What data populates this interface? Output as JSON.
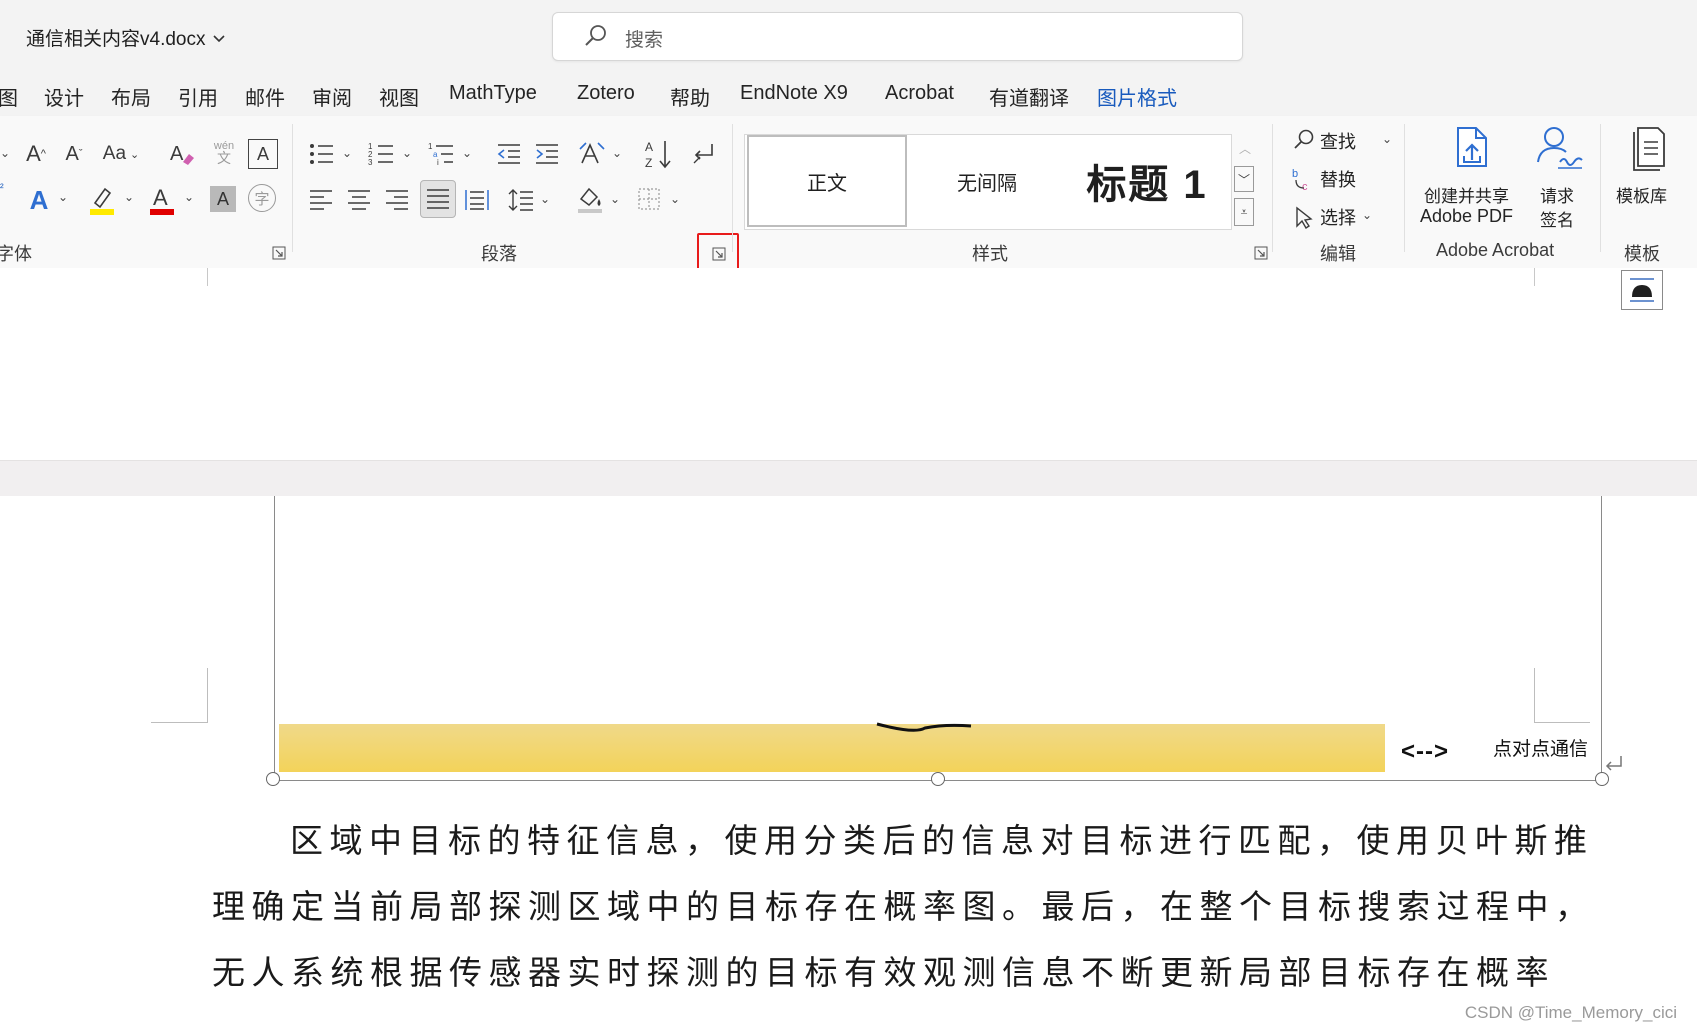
{
  "titlebar": {
    "document_title": "通信相关内容v4.docx",
    "search_placeholder": "搜索"
  },
  "tabs": [
    {
      "label": "图"
    },
    {
      "label": "设计"
    },
    {
      "label": "布局"
    },
    {
      "label": "引用"
    },
    {
      "label": "邮件"
    },
    {
      "label": "审阅"
    },
    {
      "label": "视图"
    },
    {
      "label": "MathType"
    },
    {
      "label": "Zotero"
    },
    {
      "label": "帮助"
    },
    {
      "label": "EndNote X9"
    },
    {
      "label": "Acrobat"
    },
    {
      "label": "有道翻译"
    },
    {
      "label": "图片格式"
    }
  ],
  "ribbon": {
    "font_group": {
      "label": "字体",
      "change_case": "Aa",
      "phonetic_top": "wén",
      "phonetic_bottom": "文",
      "enclose_char": "字",
      "char_border": "A",
      "font_color_hex": "#e00000",
      "highlight_hex": "#ffea00"
    },
    "paragraph_group": {
      "label": "段落"
    },
    "styles_group": {
      "label": "样式",
      "items": [
        {
          "label": "正文"
        },
        {
          "label": "无间隔"
        },
        {
          "label": "标题 1"
        }
      ]
    },
    "editing_group": {
      "label": "编辑",
      "find": "查找",
      "replace": "替换",
      "select": "选择"
    },
    "acrobat_group": {
      "label": "Adobe Acrobat",
      "create_pdf_line1": "创建并共享",
      "create_pdf_line2": "Adobe PDF",
      "request_sign_line1": "请求",
      "request_sign_line2": "签名"
    },
    "template_group": {
      "label": "模板",
      "template_library": "模板库"
    }
  },
  "document": {
    "figure_label": "点对点通信",
    "figure_arrow": "<-->",
    "paragraph_lines": [
      "区域中目标的特征信息，使用分类后的信息对目标进行匹配，使用贝叶斯推",
      "理确定当前局部探测区域中的目标存在概率图。最后，在整个目标搜索过程中，",
      "无人系统根据传感器实时探测的目标有效观测信息不断更新局部目标存在概率"
    ]
  },
  "watermark": "CSDN @Time_Memory_cici",
  "colors": {
    "accent": "#185abd",
    "highlight_box": "#e81b1b",
    "figure_band_top": "#f0d98a",
    "figure_band_bottom": "#f3d35a"
  }
}
